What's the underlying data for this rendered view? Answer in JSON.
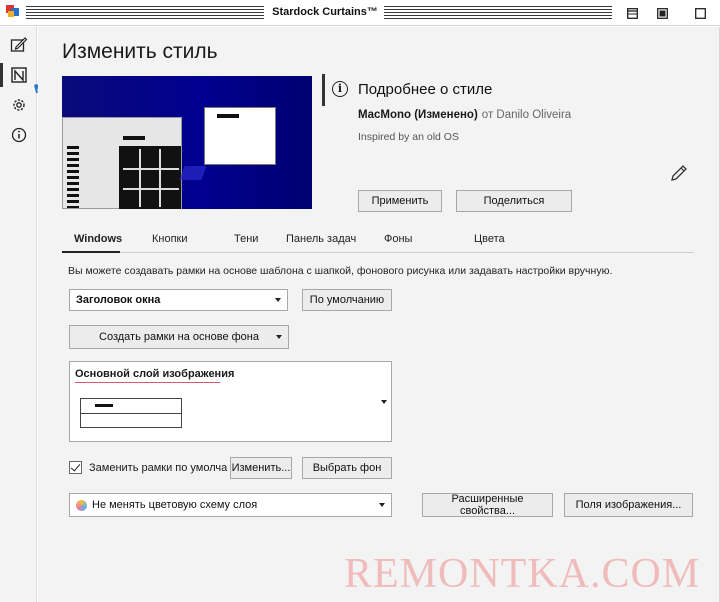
{
  "window": {
    "title": "Stardock Curtains™"
  },
  "rail": {
    "items": [
      {
        "icon": "style-edit-icon"
      },
      {
        "icon": "style-designer-icon"
      },
      {
        "icon": "settings-gear-icon"
      },
      {
        "icon": "info-icon"
      }
    ]
  },
  "page": {
    "title": "Изменить стиль"
  },
  "info": {
    "heading": "Подробнее о стиле",
    "style_name": "MacMono (Изменено)",
    "by_author": "от Danilo Oliveira",
    "description": "Inspired by an old OS",
    "apply_label": "Применить",
    "share_label": "Поделиться"
  },
  "tabs": [
    {
      "label": "Windows",
      "active": true
    },
    {
      "label": "Кнопки",
      "active": false
    },
    {
      "label": "Тени",
      "active": false
    },
    {
      "label": "Панель задач",
      "active": false
    },
    {
      "label": "Фоны",
      "active": false
    },
    {
      "label": "Цвета",
      "active": false
    }
  ],
  "content": {
    "description": "Вы можете создавать рамки на основе шаблона с шапкой, фонового рисунка или задавать настройки вручную.",
    "title_select": "Заголовок окна",
    "default_label": "По умолчанию",
    "frames_label": "Создать рамки на основе фона",
    "layer_title": "Основной слой изображения",
    "replace_checkbox_label": "Заменить рамки по умолча",
    "replace_checked": true,
    "change_label": "Изменить...",
    "pick_bg_label": "Выбрать фон",
    "scheme_select": "Не менять цветовую схему слоя",
    "advanced_label": "Расширенные свойства...",
    "image_fields_label": "Поля изображения..."
  },
  "watermark": "REMONTKA.COM",
  "colors": {
    "accent_arrow": "#2a78d0",
    "preview_bg": "#000090"
  }
}
